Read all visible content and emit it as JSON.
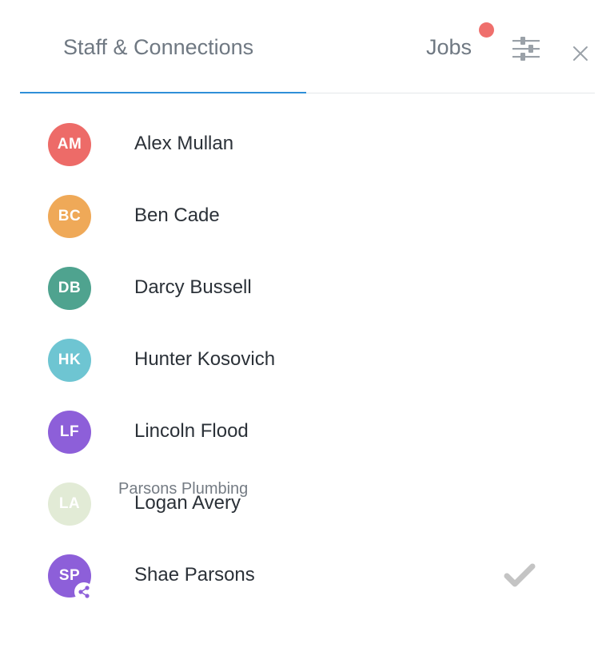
{
  "header": {
    "tabs": [
      {
        "label": "Staff & Connections",
        "active": true
      },
      {
        "label": "Jobs",
        "active": false,
        "has_notification": true
      }
    ],
    "filter_icon": "sliders-icon",
    "close_icon": "close-icon"
  },
  "colors": {
    "accent": "#2f8fd8",
    "notification": "#ef6f6c",
    "check": "#c4c4c4"
  },
  "staff": [
    {
      "initials": "AM",
      "name": "Alex Mullan",
      "color": "#ed6b68"
    },
    {
      "initials": "BC",
      "name": "Ben Cade",
      "color": "#efa958"
    },
    {
      "initials": "DB",
      "name": "Darcy Bussell",
      "color": "#4fa38f"
    },
    {
      "initials": "HK",
      "name": "Hunter Kosovich",
      "color": "#6ec5d2"
    },
    {
      "initials": "LF",
      "name": "Lincoln Flood",
      "color": "#8d5fd9"
    },
    {
      "initials": "LA",
      "name": "Logan Avery",
      "color": "#e2ebd6"
    },
    {
      "initials": "SP",
      "name": "Shae Parsons",
      "color": "#8d5fd9",
      "company": "Parsons Plumbing",
      "shared": true,
      "selected": true
    }
  ]
}
